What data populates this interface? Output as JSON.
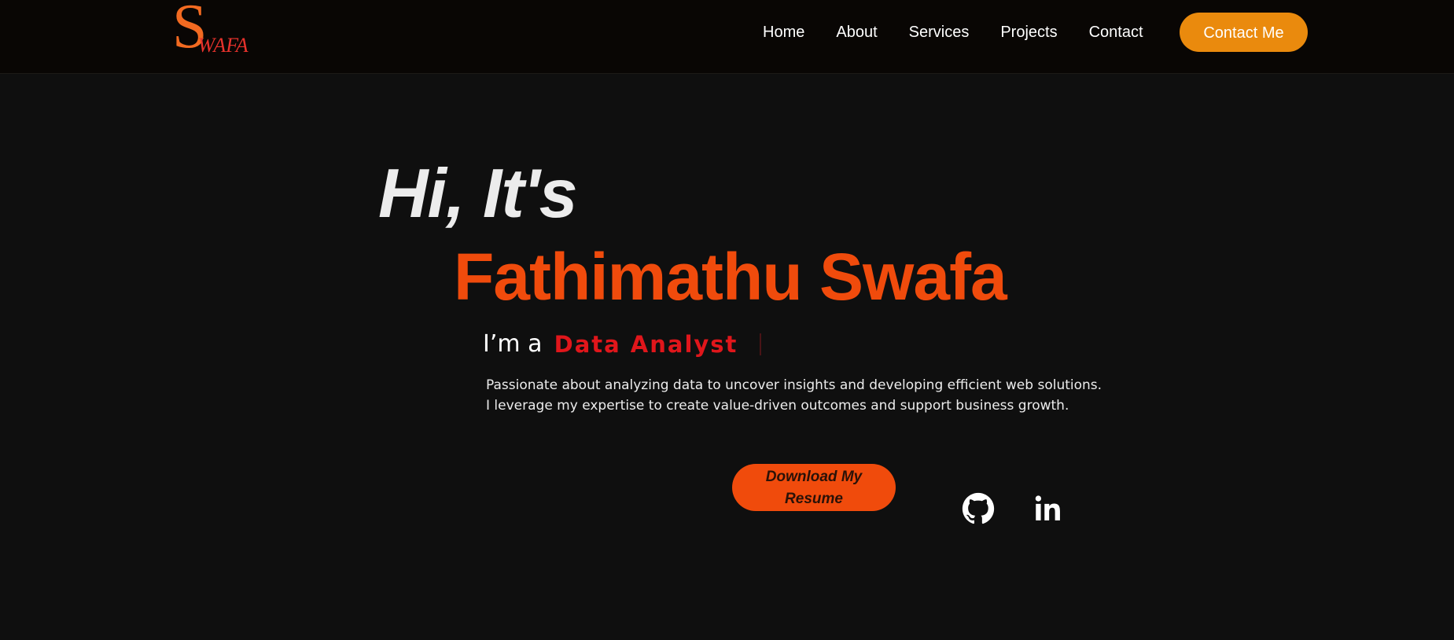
{
  "header": {
    "logo": {
      "initial": "S",
      "rest": "WAFA"
    },
    "nav": [
      {
        "label": "Home"
      },
      {
        "label": "About"
      },
      {
        "label": "Services"
      },
      {
        "label": "Projects"
      },
      {
        "label": "Contact"
      }
    ],
    "cta_label": "Contact Me"
  },
  "hero": {
    "greeting": "Hi, It's",
    "name": "Fathimathu Swafa",
    "role_prefix": "I’m a",
    "role": "Data Analyst",
    "description_lines": [
      "Passionate about analyzing data to uncover insights and developing efficient web solutions.",
      "I leverage my expertise to create value-driven outcomes and support business growth."
    ],
    "resume_button": "Download My Resume",
    "social": [
      {
        "icon": "github-icon"
      },
      {
        "icon": "linkedin-icon"
      }
    ]
  },
  "colors": {
    "background": "#0f0f0f",
    "navbar": "#090604",
    "accent_orange": "#f04b0c",
    "cta_orange": "#ea8a0d",
    "role_red": "#e0161b"
  }
}
